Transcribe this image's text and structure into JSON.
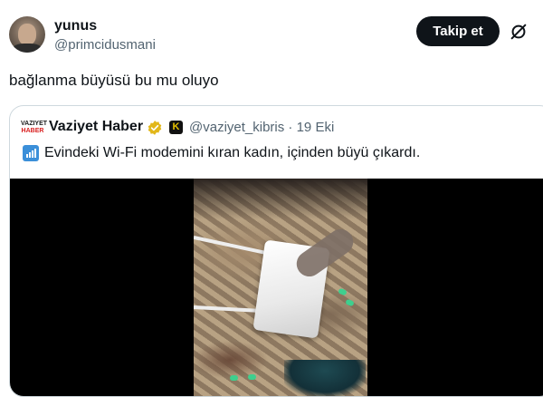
{
  "user": {
    "name": "yunus",
    "handle": "@primcidusmani",
    "follow_label": "Takip et"
  },
  "tweet": {
    "text": "bağlanma büyüsü bu mu oluyo"
  },
  "quote": {
    "logo_line1": "VAZIYET",
    "logo_line2": "HABER",
    "name": "Vaziyet Haber",
    "badge": "K",
    "handle_date": "@vaziyet_kibris · 19 Eki",
    "text": "Evindeki Wi-Fi modemini kıran kadın, içinden büyü çıkardı."
  },
  "icons": {
    "grok": "grok-icon",
    "verified": "verified-badge-icon",
    "signal": "signal-bars-icon"
  },
  "colors": {
    "follow_bg": "#0f1419",
    "verified_gold": "#e2b719",
    "secondary_text": "#536471"
  }
}
